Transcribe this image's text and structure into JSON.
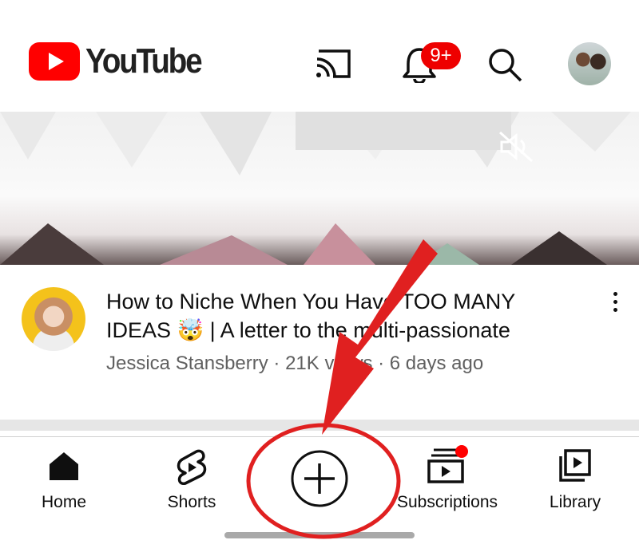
{
  "header": {
    "logo_text": "YouTube",
    "notification_badge": "9+",
    "icons": [
      "cast-icon",
      "bell-icon",
      "search-icon",
      "avatar"
    ]
  },
  "video": {
    "title": "How to Niche When You Have TOO MANY IDEAS 🤯 | A letter to the multi-passionate",
    "channel": "Jessica Stansberry",
    "views": "21K views",
    "age": "6 days ago",
    "meta": "Jessica Stansberry · 21K views · 6 days ago"
  },
  "nav": {
    "items": [
      {
        "label": "Home",
        "icon": "home-icon"
      },
      {
        "label": "Shorts",
        "icon": "shorts-icon"
      },
      {
        "label": "",
        "icon": "create-plus-icon"
      },
      {
        "label": "Subscriptions",
        "icon": "subscriptions-icon"
      },
      {
        "label": "Library",
        "icon": "library-icon"
      }
    ]
  },
  "colors": {
    "brand_red": "#ff0000",
    "annotation_red": "#e02020",
    "text_primary": "#0f0f0f",
    "text_secondary": "#606060"
  }
}
